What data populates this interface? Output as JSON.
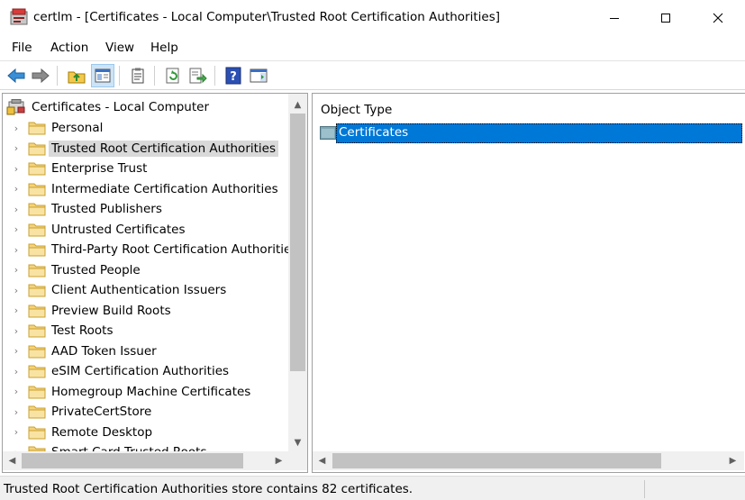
{
  "window": {
    "title": "certlm - [Certificates - Local Computer\\Trusted Root Certification Authorities]"
  },
  "menu": {
    "items": [
      "File",
      "Action",
      "View",
      "Help"
    ]
  },
  "toolbar": {
    "buttons": [
      "back-icon",
      "forward-icon",
      "up-folder-icon",
      "show-hide-tree-icon",
      "properties-icon",
      "refresh-icon",
      "export-list-icon",
      "help-icon",
      "action-pane-icon"
    ]
  },
  "tree": {
    "root": "Certificates - Local Computer",
    "items": [
      {
        "label": "Personal"
      },
      {
        "label": "Trusted Root Certification Authorities",
        "selected": true
      },
      {
        "label": "Enterprise Trust"
      },
      {
        "label": "Intermediate Certification Authorities"
      },
      {
        "label": "Trusted Publishers"
      },
      {
        "label": "Untrusted Certificates"
      },
      {
        "label": "Third-Party Root Certification Authorities"
      },
      {
        "label": "Trusted People"
      },
      {
        "label": "Client Authentication Issuers"
      },
      {
        "label": "Preview Build Roots"
      },
      {
        "label": "Test Roots"
      },
      {
        "label": "AAD Token Issuer"
      },
      {
        "label": "eSIM Certification Authorities"
      },
      {
        "label": "Homegroup Machine Certificates"
      },
      {
        "label": "PrivateCertStore"
      },
      {
        "label": "Remote Desktop"
      },
      {
        "label": "Smart Card Trusted Roots"
      }
    ]
  },
  "list": {
    "column_header": "Object Type",
    "rows": [
      {
        "label": "Certificates",
        "selected": true
      }
    ]
  },
  "status": {
    "text": "Trusted Root Certification Authorities store contains 82 certificates."
  },
  "colors": {
    "selection_blue": "#0078d7",
    "tree_selection_gray": "#d9d9d9",
    "folder_yellow": "#f5d37a"
  }
}
